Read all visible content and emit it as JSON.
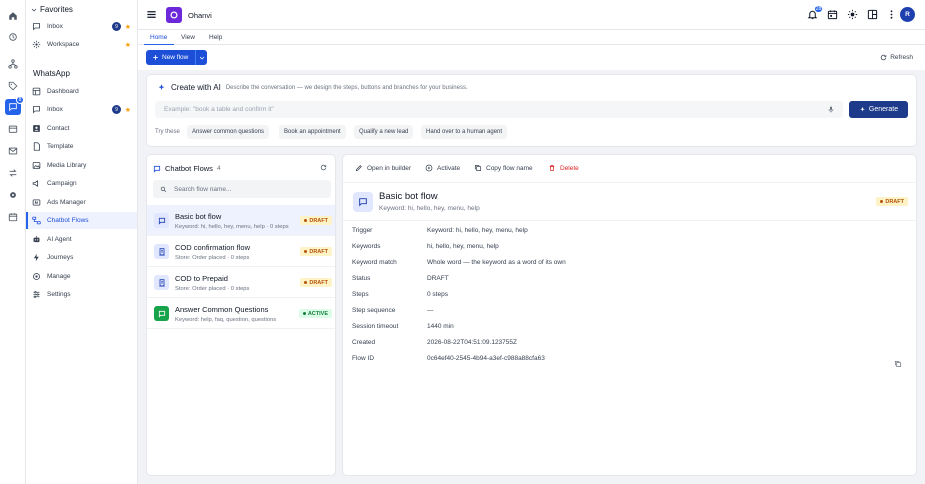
{
  "rail": {
    "chats_badge": "8"
  },
  "sidebar": {
    "favorites_title": "Favorites",
    "favorites": [
      {
        "label": "Inbox",
        "count": "9"
      },
      {
        "label": "Workspace"
      }
    ],
    "whatsapp_title": "WhatsApp",
    "items": [
      {
        "label": "Dashboard"
      },
      {
        "label": "Inbox",
        "count": "9"
      },
      {
        "label": "Contact"
      },
      {
        "label": "Template"
      },
      {
        "label": "Media Library"
      },
      {
        "label": "Campaign"
      },
      {
        "label": "Ads Manager"
      },
      {
        "label": "Chatbot Flows"
      },
      {
        "label": "AI Agent"
      },
      {
        "label": "Journeys"
      },
      {
        "label": "Manage"
      },
      {
        "label": "Settings"
      }
    ]
  },
  "topbar": {
    "brand": "Ohanvi",
    "notif_count": "28",
    "avatar": "R"
  },
  "tabs": [
    "Home",
    "View",
    "Help"
  ],
  "toolbar": {
    "new_flow": "New flow",
    "refresh": "Refresh"
  },
  "ai": {
    "title": "Create with AI",
    "desc": "Describe the conversation — we design the steps, buttons and branches for your business.",
    "placeholder": "Example: \"book a table and confirm it\"",
    "generate": "Generate",
    "try_label": "Try these",
    "chips": [
      "Answer common questions",
      "Book an appointment",
      "Qualify a new lead",
      "Hand over to a human agent"
    ]
  },
  "list": {
    "title": "Chatbot Flows",
    "count": "4",
    "search_placeholder": "Search flow name...",
    "flows": [
      {
        "name": "Basic bot flow",
        "sub": "Keyword: hi, hello, hey, menu, help · 0 steps",
        "status": "DRAFT"
      },
      {
        "name": "COD confirmation flow",
        "sub": "Store: Order placed · 0 steps",
        "status": "DRAFT"
      },
      {
        "name": "COD to Prepaid",
        "sub": "Store: Order placed · 0 steps",
        "status": "DRAFT"
      },
      {
        "name": "Answer Common Questions",
        "sub": "Keyword: help, faq, question, questions",
        "status": "ACTIVE"
      }
    ]
  },
  "detail": {
    "actions": {
      "open": "Open in builder",
      "activate": "Activate",
      "copy": "Copy flow name",
      "delete": "Delete"
    },
    "name": "Basic bot flow",
    "keyword_line": "Keyword: hi, hello, hey, menu, help",
    "status_badge": "DRAFT",
    "fields": [
      {
        "k": "Trigger",
        "v": "Keyword: hi, hello, hey, menu, help"
      },
      {
        "k": "Keywords",
        "v": "hi, hello, hey, menu, help"
      },
      {
        "k": "Keyword match",
        "v": "Whole word — the keyword as a word of its own"
      },
      {
        "k": "Status",
        "v": "DRAFT"
      },
      {
        "k": "Steps",
        "v": "0 steps"
      },
      {
        "k": "Step sequence",
        "v": "—"
      },
      {
        "k": "Session timeout",
        "v": "1440 min"
      },
      {
        "k": "Created",
        "v": "2026-08-22T04:51:09.123755Z"
      },
      {
        "k": "Flow ID",
        "v": "0c64ef40-2545-4b94-a3ef-c988a88cfa63"
      }
    ]
  },
  "colors": {
    "accent": "#1d4ed8",
    "brand": "#6d28d9",
    "draft": "#b45309",
    "active": "#15803d",
    "danger": "#dc2626"
  }
}
